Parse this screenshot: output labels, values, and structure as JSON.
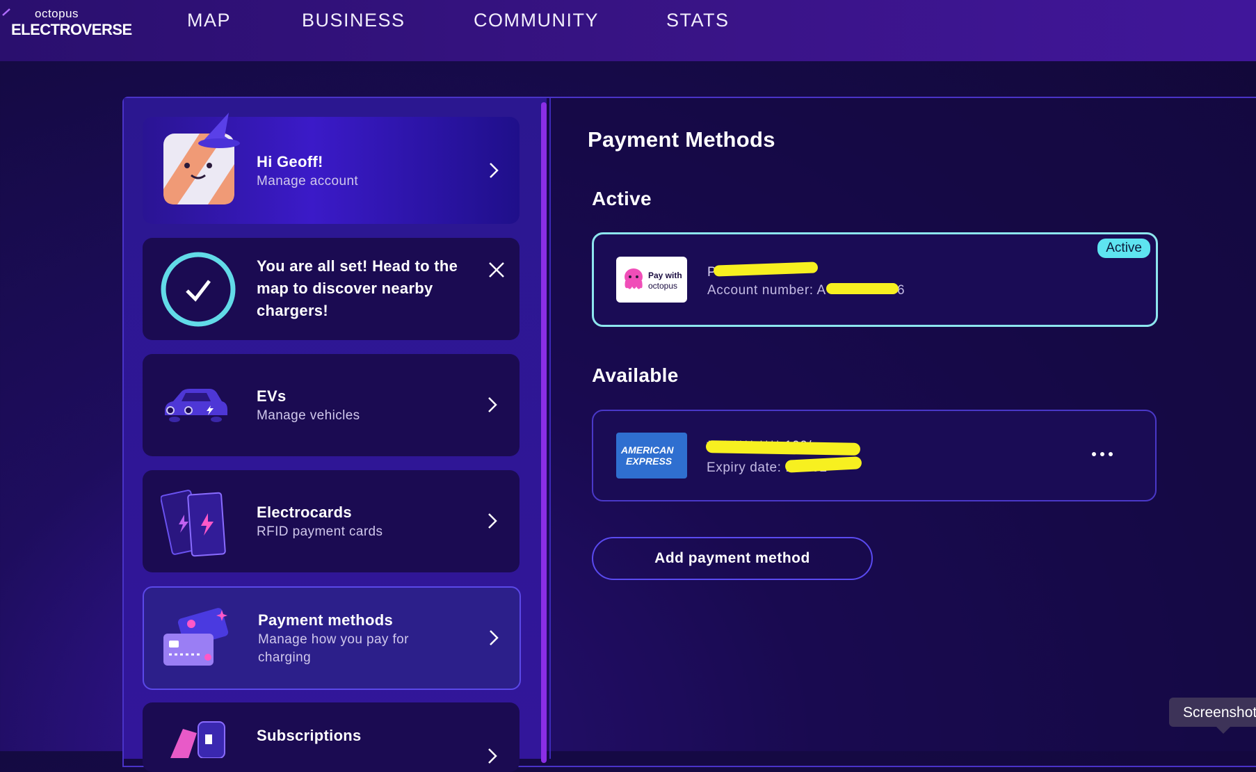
{
  "brand": {
    "small": "octopus",
    "big": "ELECTROVERSE"
  },
  "nav": {
    "map": "MAP",
    "business": "BUSINESS",
    "community": "COMMUNITY",
    "stats": "STATS"
  },
  "sidebar": {
    "account": {
      "title": "Hi Geoff!",
      "subtitle": "Manage account"
    },
    "notice": {
      "line1": "You are all set! Head to the",
      "line2": "map to discover nearby",
      "line3": "chargers!"
    },
    "evs": {
      "title": "EVs",
      "subtitle": "Manage vehicles"
    },
    "electrocards": {
      "title": "Electrocards",
      "subtitle": "RFID payment cards"
    },
    "payment": {
      "title": "Payment methods",
      "subtitle1": "Manage how you pay for",
      "subtitle2": "charging"
    },
    "subscriptions": {
      "title": "Subscriptions"
    }
  },
  "main": {
    "title": "Payment Methods",
    "active_heading": "Active",
    "available_heading": "Available",
    "active_method": {
      "logo_line1": "Pay with",
      "logo_line2": "octopus",
      "name": "Pri",
      "account_prefix": "Account number: A",
      "account_suffix": "6",
      "badge": "Active"
    },
    "available_method": {
      "logo_line1": "AMERICAN",
      "logo_line2": "EXPRESS",
      "number": "**** **** **** 100/",
      "expiry": "Expiry date: 11/202"
    },
    "add_button": "Add payment method"
  },
  "tooltip": "Screenshot",
  "colors": {
    "accent": "#5a4af0",
    "active_border": "#8de6ee",
    "badge": "#5ee4f0",
    "highlight": "#f7f020"
  }
}
